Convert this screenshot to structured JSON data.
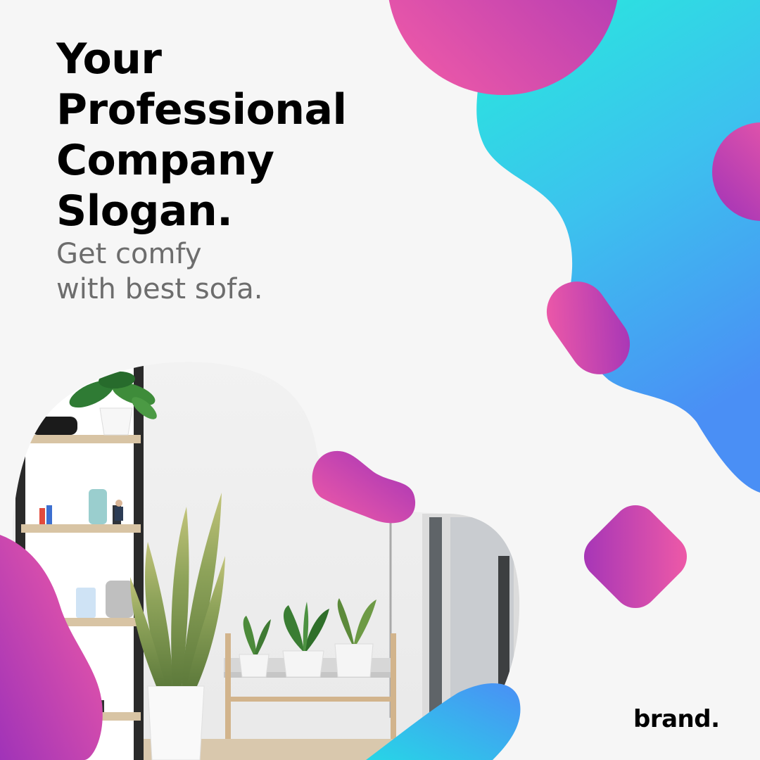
{
  "headline": {
    "lines": [
      "Your",
      "Professional",
      "Company",
      "Slogan."
    ]
  },
  "subheadline": {
    "lines": [
      "Get comfy",
      "with best sofa."
    ]
  },
  "brand": "brand.",
  "colors": {
    "background": "#f6f6f6",
    "headline": "#000000",
    "subheadline": "#6d6d6d",
    "gradient_pink": "#f45ca6",
    "gradient_purple": "#a033b8",
    "gradient_cyan": "#27ebdc",
    "gradient_blue": "#4a8ff5"
  }
}
